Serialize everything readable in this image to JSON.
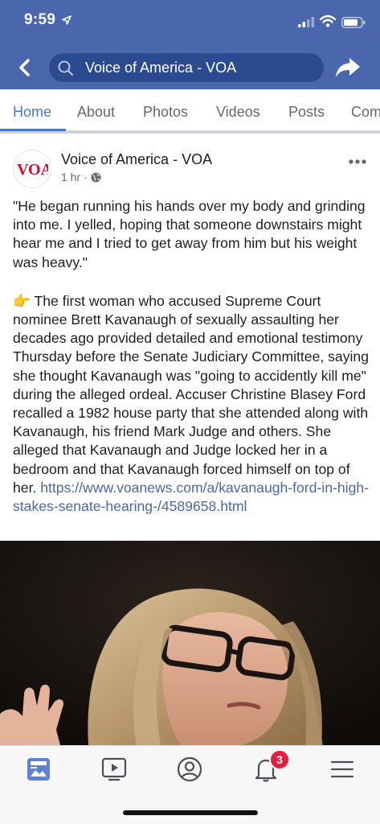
{
  "status_bar": {
    "time": "9:59",
    "icons": [
      "location-arrow-icon",
      "signal-icon",
      "wifi-icon",
      "battery-icon"
    ]
  },
  "header": {
    "search_text": "Voice of America - VOA",
    "icons": [
      "back-icon",
      "search-icon",
      "share-icon"
    ],
    "bg_color": "#4a67ad"
  },
  "tabs": [
    {
      "label": "Home",
      "active": true
    },
    {
      "label": "About",
      "active": false
    },
    {
      "label": "Photos",
      "active": false
    },
    {
      "label": "Videos",
      "active": false
    },
    {
      "label": "Posts",
      "active": false
    },
    {
      "label": "Com",
      "active": false
    }
  ],
  "post": {
    "page_name": "Voice of America - VOA",
    "time": "1 hr",
    "separator": "·",
    "avatar_logo": "VOA",
    "quote": "\"He began running his hands over my body and grinding into me. I yelled, hoping that someone downstairs might hear me and I tried to get away from him but his weight was heavy.\"",
    "body_emoji": "👉",
    "body": "The first woman who accused Supreme Court nominee Brett Kavanaugh of sexually assaulting her decades ago provided detailed and emotional testimony Thursday before the Senate Judiciary Committee, saying she thought Kavanaugh was \"going to accidently kill me\" during the alleged ordeal. Accuser Christine Blasey Ford recalled a 1982 house party that she attended along with Kavanaugh, his friend Mark Judge and others. She alleged that Kavanaugh and Judge locked her in a bedroom and that Kavanaugh forced himself on top of her.",
    "link": "https://www.voanews.com/a/kavanaugh-ford-in-high-stakes-senate-hearing-/4589658.html"
  },
  "bottom_nav": {
    "items": [
      "news-feed-icon",
      "watch-video-icon",
      "profile-icon",
      "notifications-bell-icon",
      "menu-icon"
    ],
    "notification_count": "3"
  },
  "colors": {
    "accent": "#4a76d0",
    "link": "#4a67ad",
    "badge": "#e41e3f"
  }
}
